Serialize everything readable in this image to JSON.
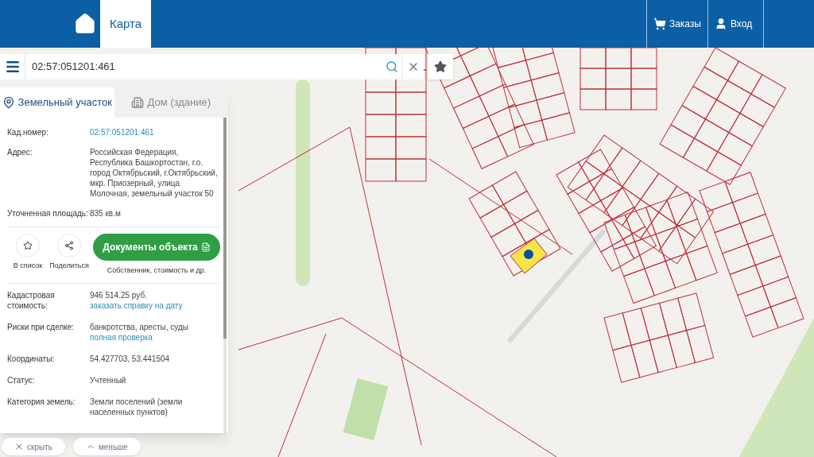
{
  "header": {
    "tabs": [
      {
        "label": "Карта",
        "selected": true
      }
    ],
    "actions": [
      {
        "kind": "cart",
        "label": "Заказы"
      },
      {
        "kind": "user",
        "label": "Вход"
      }
    ]
  },
  "search": {
    "value": "02:57:051201:461"
  },
  "panel": {
    "tabs": [
      {
        "label": "Земельный участок",
        "kind": "parcel",
        "selected": true
      },
      {
        "label": "Дом (здание)",
        "kind": "building",
        "selected": false
      }
    ],
    "top_rows": [
      {
        "label": "Кад.номер:",
        "value": "02:57:051201:461",
        "value_is_link": true
      },
      {
        "label": "Адрес:",
        "value": "Российская Федерация, Республика Башкортостан, г.о. город Октябрьский, г.Октябрьский, мкр. Приозерный, улица Молочная, земельный участок 50",
        "value_is_link": false
      },
      {
        "label": "Уточненная площадь:",
        "value": "835 кв.м",
        "value_is_link": false
      }
    ],
    "actions": [
      {
        "kind": "star",
        "label": "В список"
      },
      {
        "kind": "share",
        "label": "Поделиться"
      }
    ],
    "documents_button": "Документы объекта",
    "documents_note": "Собственник, стоимость и др.",
    "bottom_rows": [
      {
        "label": "Кадастровая стоимость:",
        "value": "946 514.25 руб.",
        "link": "заказать справку на дату"
      },
      {
        "label": "Риски при сделке:",
        "value": "банкротства, аресты, суды",
        "link": "полная проверка"
      },
      {
        "label": "Координаты:",
        "value": "54.427703, 53.441504"
      },
      {
        "label": "Статус:",
        "value": "Учтенный"
      },
      {
        "label": "Категория земель:",
        "value": "Земли поселений (земли населенных пунктов)"
      }
    ]
  },
  "footer_buttons": [
    {
      "kind": "close",
      "label": "скрыть"
    },
    {
      "kind": "up",
      "label": "меньше"
    }
  ]
}
